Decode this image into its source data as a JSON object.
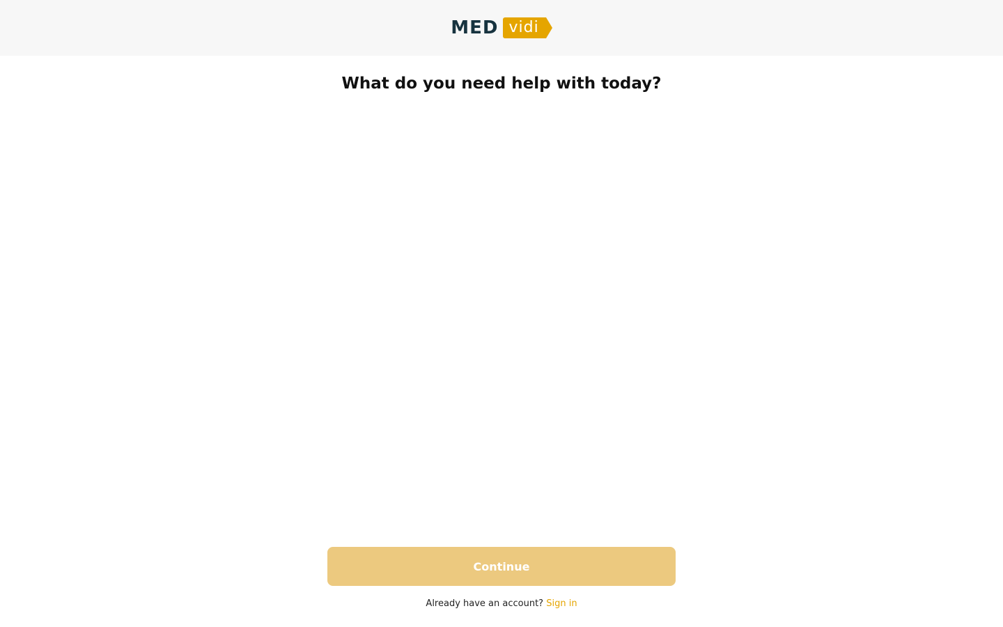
{
  "header": {
    "logo_part1": "MED",
    "logo_part2": "vidi"
  },
  "main": {
    "title": "What do you need help with today?",
    "continue_label": "Continue",
    "account_prompt": "Already have an account?",
    "signin_label": "Sign in"
  },
  "colors": {
    "brand_dark": "#17333f",
    "brand_accent": "#e5a500",
    "button_disabled": "#ecc97f",
    "header_bg": "#f7f7f7"
  }
}
